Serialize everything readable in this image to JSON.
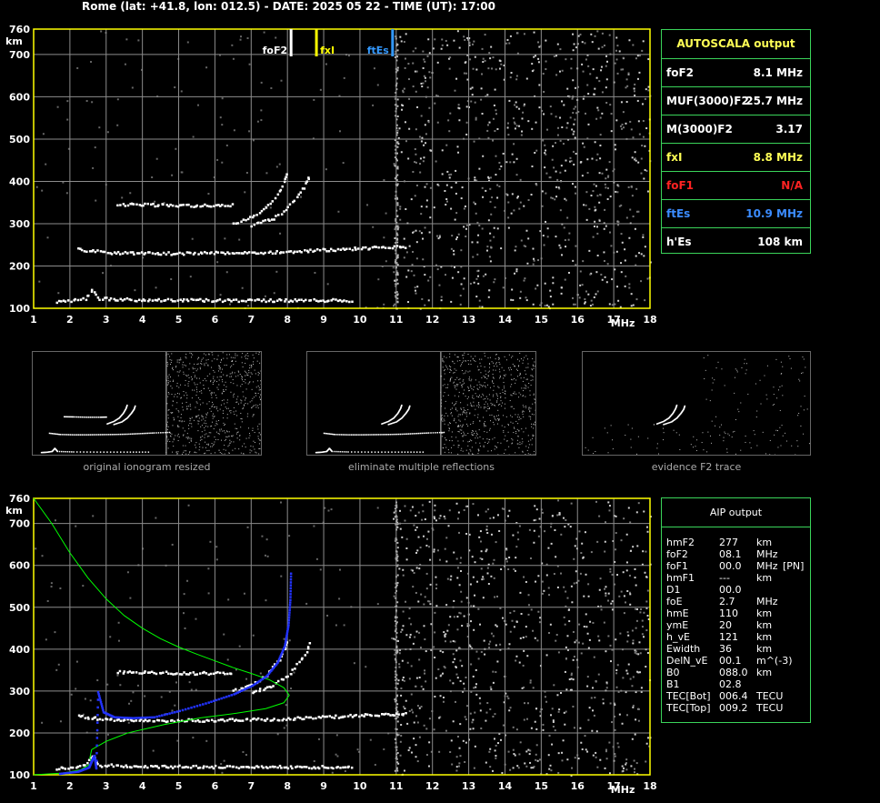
{
  "header": {
    "title": "Rome (lat: +41.8, lon: 012.5) - DATE: 2025 05 22 - TIME (UT): 17:00"
  },
  "colors": {
    "axis": "#ffff00",
    "grid": "#8c8c8c",
    "panel_border": "#3ad45a",
    "aip_curve": "#00ff00",
    "profile": "#2233ff"
  },
  "chart_data": [
    {
      "type": "scatter",
      "id": "ionogram-top",
      "xlabel": "MHz",
      "ylabel": "km",
      "xlim": [
        1,
        18
      ],
      "ylim": [
        100,
        760
      ],
      "x_ticks": [
        1,
        2,
        3,
        4,
        5,
        6,
        7,
        8,
        9,
        10,
        11,
        12,
        13,
        14,
        15,
        16,
        17,
        18
      ],
      "y_ticks": [
        100,
        200,
        300,
        400,
        500,
        600,
        700,
        760
      ],
      "markers": [
        {
          "label": "foF2",
          "x": 8.1,
          "color": "#ffffff"
        },
        {
          "label": "fxI",
          "x": 8.8,
          "color": "#ffff00"
        },
        {
          "label": "ftEs",
          "x": 10.9,
          "color": "#3399ff"
        }
      ],
      "traces": [
        {
          "name": "Es",
          "points": [
            [
              1.6,
              118
            ],
            [
              2.0,
              120
            ],
            [
              2.4,
              125
            ],
            [
              2.6,
              145
            ],
            [
              2.8,
              125
            ],
            [
              4,
              122
            ],
            [
              6,
              121
            ],
            [
              8,
              121
            ],
            [
              9.8,
              121
            ]
          ]
        },
        {
          "name": "F-o",
          "points": [
            [
              2.2,
              242
            ],
            [
              3,
              234
            ],
            [
              4,
              232
            ],
            [
              5,
              232
            ],
            [
              6,
              233
            ],
            [
              7,
              234
            ],
            [
              8,
              236
            ],
            [
              9,
              240
            ],
            [
              10,
              244
            ],
            [
              11.3,
              248
            ]
          ]
        },
        {
          "name": "F2-o",
          "points": [
            [
              6.5,
              302
            ],
            [
              7,
              318
            ],
            [
              7.4,
              340
            ],
            [
              7.7,
              370
            ],
            [
              7.9,
              400
            ],
            [
              8.0,
              425
            ]
          ]
        },
        {
          "name": "F2-x",
          "points": [
            [
              7.0,
              298
            ],
            [
              7.6,
              315
            ],
            [
              8.0,
              340
            ],
            [
              8.3,
              370
            ],
            [
              8.5,
              395
            ],
            [
              8.6,
              420
            ]
          ]
        },
        {
          "name": "multiple",
          "points": [
            [
              3.3,
              348
            ],
            [
              4,
              347
            ],
            [
              5,
              345
            ],
            [
              6,
              345
            ],
            [
              6.5,
              346
            ]
          ]
        }
      ]
    },
    {
      "type": "scatter",
      "id": "ionogram-bottom",
      "xlabel": "MHz",
      "ylabel": "km",
      "xlim": [
        1,
        18
      ],
      "ylim": [
        100,
        760
      ],
      "x_ticks": [
        1,
        2,
        3,
        4,
        5,
        6,
        7,
        8,
        9,
        10,
        11,
        12,
        13,
        14,
        15,
        16,
        17,
        18
      ],
      "y_ticks": [
        100,
        200,
        300,
        400,
        500,
        600,
        700,
        760
      ],
      "green_curve": [
        [
          1.0,
          760
        ],
        [
          1.5,
          700
        ],
        [
          2.0,
          630
        ],
        [
          2.5,
          570
        ],
        [
          3.0,
          520
        ],
        [
          3.5,
          480
        ],
        [
          4.0,
          450
        ],
        [
          4.5,
          425
        ],
        [
          5.0,
          405
        ],
        [
          5.5,
          388
        ],
        [
          6.0,
          372
        ],
        [
          6.5,
          356
        ],
        [
          7.0,
          342
        ],
        [
          7.5,
          327
        ],
        [
          7.9,
          308
        ],
        [
          8.05,
          290
        ],
        [
          7.9,
          272
        ],
        [
          7.4,
          258
        ],
        [
          6.6,
          247
        ],
        [
          5.6,
          236
        ],
        [
          4.6,
          220
        ],
        [
          3.6,
          200
        ],
        [
          3.0,
          180
        ],
        [
          2.6,
          160
        ],
        [
          2.55,
          140
        ],
        [
          2.6,
          128
        ],
        [
          2.3,
          112
        ],
        [
          1.8,
          104
        ],
        [
          1.0,
          100
        ]
      ],
      "blue_curve": [
        [
          1.7,
          105
        ],
        [
          2.2,
          110
        ],
        [
          2.5,
          120
        ],
        [
          2.6,
          140
        ],
        [
          2.65,
          148
        ],
        [
          2.7,
          118
        ],
        [
          2.75,
          300
        ],
        [
          2.9,
          252
        ],
        [
          3.2,
          240
        ],
        [
          3.7,
          238
        ],
        [
          4.3,
          240
        ],
        [
          5.0,
          255
        ],
        [
          5.8,
          275
        ],
        [
          6.5,
          295
        ],
        [
          7.0,
          315
        ],
        [
          7.4,
          338
        ],
        [
          7.7,
          370
        ],
        [
          7.9,
          410
        ],
        [
          8.0,
          460
        ],
        [
          8.05,
          520
        ],
        [
          8.07,
          590
        ]
      ]
    }
  ],
  "autoscala": {
    "title": "AUTOSCALA output",
    "rows": [
      {
        "label": "foF2",
        "value": "8.1 MHz",
        "color": "#ffffff"
      },
      {
        "label": "MUF(3000)F2",
        "value": "25.7 MHz",
        "color": "#ffffff"
      },
      {
        "label": "M(3000)F2",
        "value": "3.17",
        "color": "#ffffff"
      },
      {
        "label": "fxI",
        "value": "8.8 MHz",
        "color": "#ffff55"
      },
      {
        "label": "foF1",
        "value": "N/A",
        "color": "#ff2222"
      },
      {
        "label": "ftEs",
        "value": "10.9 MHz",
        "color": "#3b8cff"
      },
      {
        "label": "h'Es",
        "value": "108    km",
        "color": "#ffffff"
      }
    ]
  },
  "thumbnails": [
    {
      "caption": "original ionogram resized"
    },
    {
      "caption": "eliminate multiple reflections"
    },
    {
      "caption": "evidence F2 trace"
    }
  ],
  "aip": {
    "title": "AIP output",
    "rows": [
      {
        "name": "hmF2",
        "value": "277",
        "unit": "km",
        "extra": ""
      },
      {
        "name": "foF2",
        "value": "08.1",
        "unit": "MHz",
        "extra": ""
      },
      {
        "name": "foF1",
        "value": "00.0",
        "unit": "MHz",
        "extra": "[PN]"
      },
      {
        "name": "hmF1",
        "value": "---",
        "unit": "km",
        "extra": ""
      },
      {
        "name": "D1",
        "value": "00.0",
        "unit": "",
        "extra": ""
      },
      {
        "name": "foE",
        "value": "2.7",
        "unit": "MHz",
        "extra": ""
      },
      {
        "name": "hmE",
        "value": "110",
        "unit": "km",
        "extra": ""
      },
      {
        "name": "ymE",
        "value": "20",
        "unit": "km",
        "extra": ""
      },
      {
        "name": "h_vE",
        "value": "121",
        "unit": "km",
        "extra": ""
      },
      {
        "name": "Ewidth",
        "value": "36",
        "unit": "km",
        "extra": ""
      },
      {
        "name": "DelN_vE",
        "value": "00.1",
        "unit": "m^(-3)",
        "extra": ""
      },
      {
        "name": "B0",
        "value": "088.0",
        "unit": "km",
        "extra": ""
      },
      {
        "name": "B1",
        "value": "02.8",
        "unit": "",
        "extra": ""
      },
      {
        "name": "TEC[Bot]",
        "value": "006.4",
        "unit": "TECU",
        "extra": ""
      },
      {
        "name": "TEC[Top]",
        "value": "009.2",
        "unit": "TECU",
        "extra": ""
      }
    ]
  }
}
